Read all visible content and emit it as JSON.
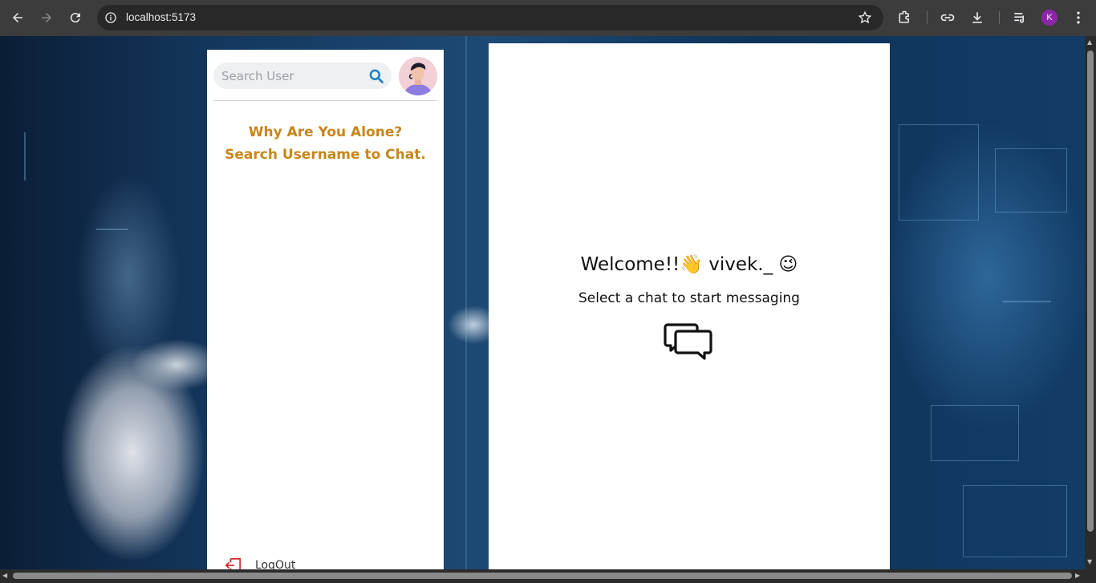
{
  "browser": {
    "url": "localhost:5173",
    "profile_initial": "K"
  },
  "sidebar": {
    "search_placeholder": "Search User",
    "empty_line1": "Why Are You Alone?",
    "empty_line2": "Search Username to Chat.",
    "logout_label": "LogOut"
  },
  "main": {
    "welcome_text": "Welcome!!👋 vivek._ 😉",
    "subtitle": "Select a chat to start messaging"
  },
  "colors": {
    "accent_orange": "#c8861a",
    "search_icon": "#1a7fc4",
    "logout_icon": "#d32f2f",
    "profile": "#8e24aa"
  }
}
